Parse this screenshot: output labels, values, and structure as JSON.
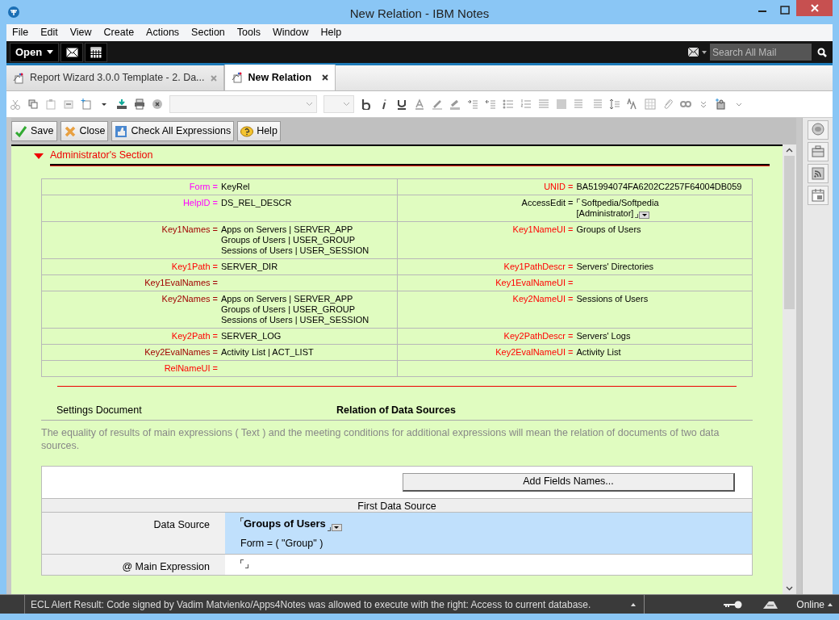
{
  "window": {
    "title": "New Relation - IBM Notes"
  },
  "menu": [
    "File",
    "Edit",
    "View",
    "Create",
    "Actions",
    "Section",
    "Tools",
    "Window",
    "Help"
  ],
  "top_bar": {
    "open_label": "Open",
    "search": {
      "placeholder": "Search All Mail"
    }
  },
  "tabs": [
    {
      "label": "Report Wizard 3.0.0 Template - 2. Da...",
      "selected": false
    },
    {
      "label": "New Relation",
      "selected": true
    }
  ],
  "action_buttons": [
    {
      "kind": "save",
      "label": "Save"
    },
    {
      "kind": "close",
      "label": "Close"
    },
    {
      "kind": "check",
      "label": "Check All Expressions"
    },
    {
      "kind": "help",
      "label": "Help"
    }
  ],
  "section": {
    "title": "Administrator's Section",
    "expanded": true
  },
  "fields": [
    {
      "left": {
        "label": "Form =",
        "color": "#ff00ff",
        "lines": [
          "KeyRel"
        ]
      },
      "right": {
        "label": "UNID =",
        "color": "#ff0000",
        "lines": [
          "BA51994074FA6202C2257F64004DB059"
        ]
      }
    },
    {
      "left": {
        "label": "HelpID =",
        "color": "#ff00ff",
        "lines": [
          "DS_REL_DESCR"
        ]
      },
      "right": {
        "label": "AccessEdit =",
        "color": "#000000",
        "kind": "dialog",
        "lines": [
          "Softpedia/Softpedia",
          "[Administrator]"
        ]
      }
    },
    {
      "left": {
        "label": "Key1Names =",
        "color": "#a00000",
        "lines": [
          "Apps on Servers | SERVER_APP",
          "Groups of Users | USER_GROUP",
          "Sessions of Users | USER_SESSION"
        ]
      },
      "right": {
        "label": "Key1NameUI =",
        "color": "#ff0000",
        "lines": [
          "Groups of Users"
        ]
      }
    },
    {
      "left": {
        "label": "Key1Path =",
        "color": "#ff0000",
        "lines": [
          "SERVER_DIR"
        ]
      },
      "right": {
        "label": "Key1PathDescr =",
        "color": "#ff0000",
        "lines": [
          "Servers' Directories"
        ]
      }
    },
    {
      "left": {
        "label": "Key1EvalNames =",
        "color": "#a00000"
      },
      "right": {
        "label": "Key1EvalNameUI =",
        "color": "#ff0000"
      }
    },
    {
      "left": {
        "label": "Key2Names =",
        "color": "#a00000",
        "lines": [
          "Apps on Servers | SERVER_APP",
          "Groups of Users | USER_GROUP",
          "Sessions of Users | USER_SESSION"
        ]
      },
      "right": {
        "label": "Key2NameUI =",
        "color": "#ff0000",
        "lines": [
          "Sessions of Users"
        ]
      }
    },
    {
      "left": {
        "label": "Key2Path =",
        "color": "#ff0000",
        "lines": [
          "SERVER_LOG"
        ]
      },
      "right": {
        "label": "Key2PathDescr =",
        "color": "#ff0000",
        "lines": [
          "Servers' Logs"
        ]
      }
    },
    {
      "left": {
        "label": "Key2EvalNames =",
        "color": "#a00000",
        "lines": [
          "Activity List | ACT_LIST"
        ]
      },
      "right": {
        "label": "Key2EvalNameUI =",
        "color": "#ff0000",
        "lines": [
          "Activity List"
        ]
      }
    },
    {
      "left": {
        "label": "RelNameUI =",
        "color": "#ff0000"
      }
    }
  ],
  "settings": {
    "label": "Settings Document",
    "heading": "Relation of Data Sources",
    "description": "The equality of results of main expressions ( Text ) and the meeting conditions for additional expressions will mean the relation of documents of two data sources."
  },
  "data_source_panel": {
    "button": "Add Fields Names...",
    "header": "First Data Source",
    "rows": [
      {
        "label": "Data Source",
        "kind": "dialog",
        "selected": true,
        "value": "Groups of Users",
        "note": "Form = ( \"Group\" )"
      },
      {
        "label": "@ Main Expression",
        "kind": "field",
        "selected": false
      }
    ]
  },
  "status_bar": {
    "message": "ECL Alert Result: Code signed by Vadim Matvienko/Apps4Notes was allowed to execute with the right: Access to current database.",
    "location": "Online"
  }
}
